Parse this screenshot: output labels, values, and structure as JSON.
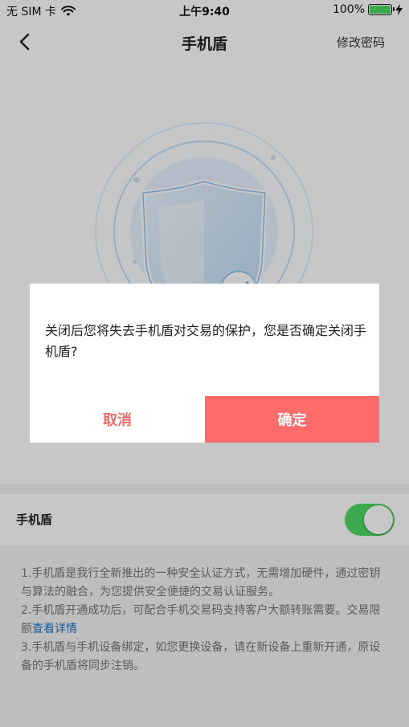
{
  "status_bar": {
    "carrier": "无 SIM 卡",
    "time": "上午9:40",
    "battery": "100%",
    "battery_level": 100
  },
  "nav": {
    "title": "手机盾",
    "action": "修改密码"
  },
  "settings": {
    "toggle_label": "手机盾",
    "toggle_on": true,
    "toggle_color": "#4cd964"
  },
  "info": {
    "line1": "1.手机盾是我行全新推出的一种安全认证方式，无需增加硬件，通过密钥与算法的融合，为您提供安全便捷的交易认证服务。",
    "line2_prefix": "2.手机盾开通成功后，可配合手机交易码支持客户大额转账需要。交易限额",
    "line2_link": "查看详情",
    "line3": "3.手机盾与手机设备绑定，如您更换设备，请在新设备上重新开通，原设备的手机盾将同步注销。"
  },
  "dialog": {
    "message": "关闭后您将失去手机盾对交易的保护，您是否确定关闭手机盾?",
    "cancel_label": "取消",
    "confirm_label": "确定",
    "confirm_color": "#ff6b6b"
  },
  "icons": {
    "back": "chevron-left-icon",
    "wifi": "wifi-icon",
    "battery": "battery-icon",
    "charging": "bolt-icon",
    "shield": "shield-icon"
  }
}
